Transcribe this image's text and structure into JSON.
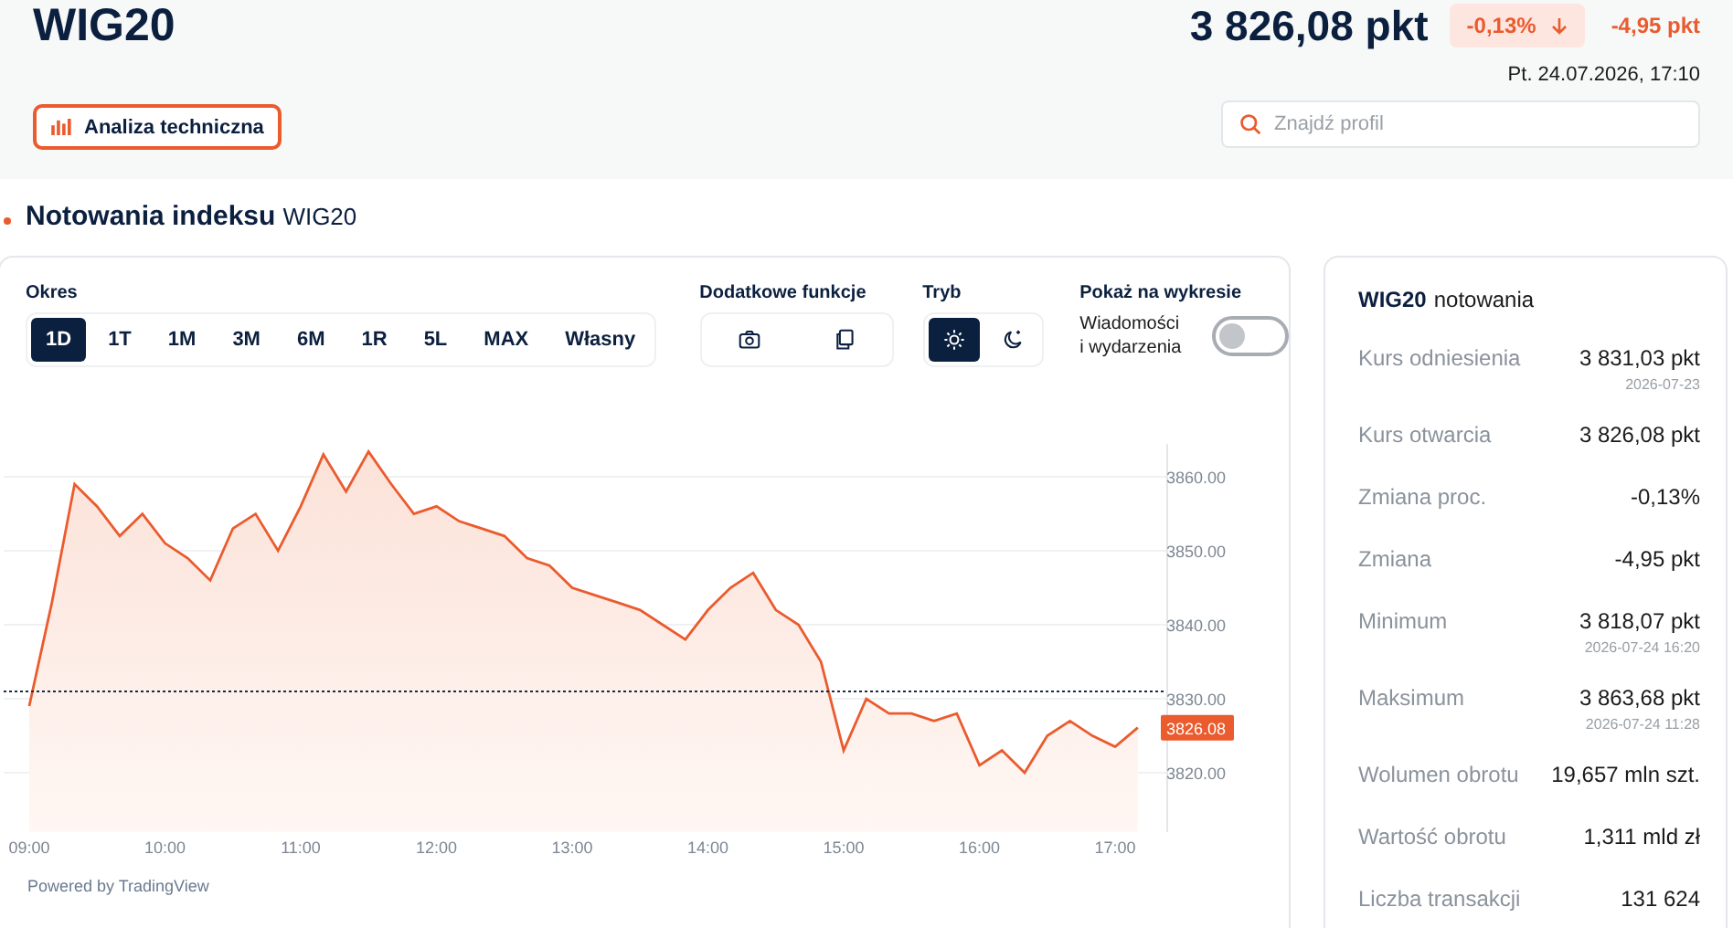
{
  "header": {
    "title": "WIG20",
    "price": "3 826,08 pkt",
    "change_percent": "-0,13%",
    "change": "-4,95 pkt",
    "timestamp": "Pt. 24.07.2026, 17:10",
    "tech_button": "Analiza techniczna",
    "search": {
      "placeholder": "Znajdź profil"
    }
  },
  "section": {
    "title": "Notowania indeksu",
    "subtitle": "WIG20"
  },
  "controls": {
    "period_label": "Okres",
    "periods": [
      {
        "label": "1D",
        "selected": true
      },
      {
        "label": "1T",
        "selected": false
      },
      {
        "label": "1M",
        "selected": false
      },
      {
        "label": "3M",
        "selected": false
      },
      {
        "label": "6M",
        "selected": false
      },
      {
        "label": "1R",
        "selected": false
      },
      {
        "label": "5L",
        "selected": false
      },
      {
        "label": "MAX",
        "selected": false
      },
      {
        "label": "Własny",
        "selected": false
      }
    ],
    "extra_label": "Dodatkowe funkcje",
    "extra_tools": [
      {
        "kind": "camera"
      },
      {
        "kind": "copy"
      }
    ],
    "mode_label": "Tryb",
    "modes": [
      {
        "kind": "light",
        "selected": true
      },
      {
        "kind": "dark",
        "selected": false
      }
    ],
    "overlay_label": "Pokaż na wykresie",
    "overlay_toggle": {
      "label": "Wiadomości i wydarzenia",
      "on": false
    }
  },
  "chart": {
    "chart_data": {
      "type": "area",
      "grid": true,
      "categories": [
        "09:00",
        null,
        null,
        null,
        null,
        null,
        "10:00",
        null,
        null,
        null,
        null,
        null,
        "11:00",
        null,
        null,
        null,
        null,
        null,
        "12:00",
        null,
        null,
        null,
        null,
        null,
        "13:00",
        null,
        null,
        null,
        null,
        null,
        "14:00",
        null,
        null,
        null,
        null,
        null,
        "15:00",
        null,
        null,
        null,
        null,
        null,
        "16:00",
        null,
        null,
        null,
        null,
        null,
        "17:00",
        null
      ],
      "series": [
        {
          "color": "#ea5b2e",
          "values": [
            3829,
            3843,
            3859,
            3856,
            3852,
            3855,
            3851,
            3849,
            3846,
            3853,
            3855,
            3850,
            3856,
            3863,
            3858,
            3863.4,
            3859,
            3855,
            3856,
            3854,
            3853,
            3852,
            3849,
            3848,
            3845,
            3844,
            3843,
            3842,
            3840,
            3838,
            3842,
            3845,
            3847,
            3842,
            3840,
            3835,
            3823,
            3830,
            3828,
            3828,
            3827,
            3828,
            3821,
            3823,
            3820,
            3825,
            3827,
            3825,
            3823.5,
            3826.1
          ]
        }
      ],
      "yticks": [
        {
          "value": 3820,
          "label": "3820.00"
        },
        {
          "value": 3830,
          "label": "3830.00"
        },
        {
          "value": 3840,
          "label": "3840.00"
        },
        {
          "value": 3850,
          "label": "3850.00"
        },
        {
          "value": 3860,
          "label": "3860.00"
        }
      ],
      "ylim": [
        3812,
        3865
      ],
      "ref_lines": [
        {
          "axis": "y",
          "value": 3831
        }
      ],
      "annotations": [
        {
          "text": "3826.08",
          "y": 3826.08
        }
      ]
    },
    "footer": "Powered by TradingView"
  },
  "stats": {
    "title": "WIG20",
    "title_suffix": "notowania",
    "rows": [
      {
        "label": "Kurs odniesienia",
        "value": "3 831,03 pkt",
        "date": "2026-07-23"
      },
      {
        "label": "Kurs otwarcia",
        "value": "3 826,08 pkt"
      },
      {
        "label": "Zmiana proc.",
        "value": "-0,13%"
      },
      {
        "label": "Zmiana",
        "value": "-4,95 pkt"
      },
      {
        "label": "Minimum",
        "value": "3 818,07 pkt",
        "date": "2026-07-24 16:20"
      },
      {
        "label": "Maksimum",
        "value": "3 863,68 pkt",
        "date": "2026-07-24 11:28"
      },
      {
        "label": "Wolumen obrotu",
        "value": "19,657 mln szt."
      },
      {
        "label": "Wartość obrotu",
        "value": "1,311 mld zł"
      },
      {
        "label": "Liczba transakcji",
        "value": "131 624"
      }
    ]
  }
}
